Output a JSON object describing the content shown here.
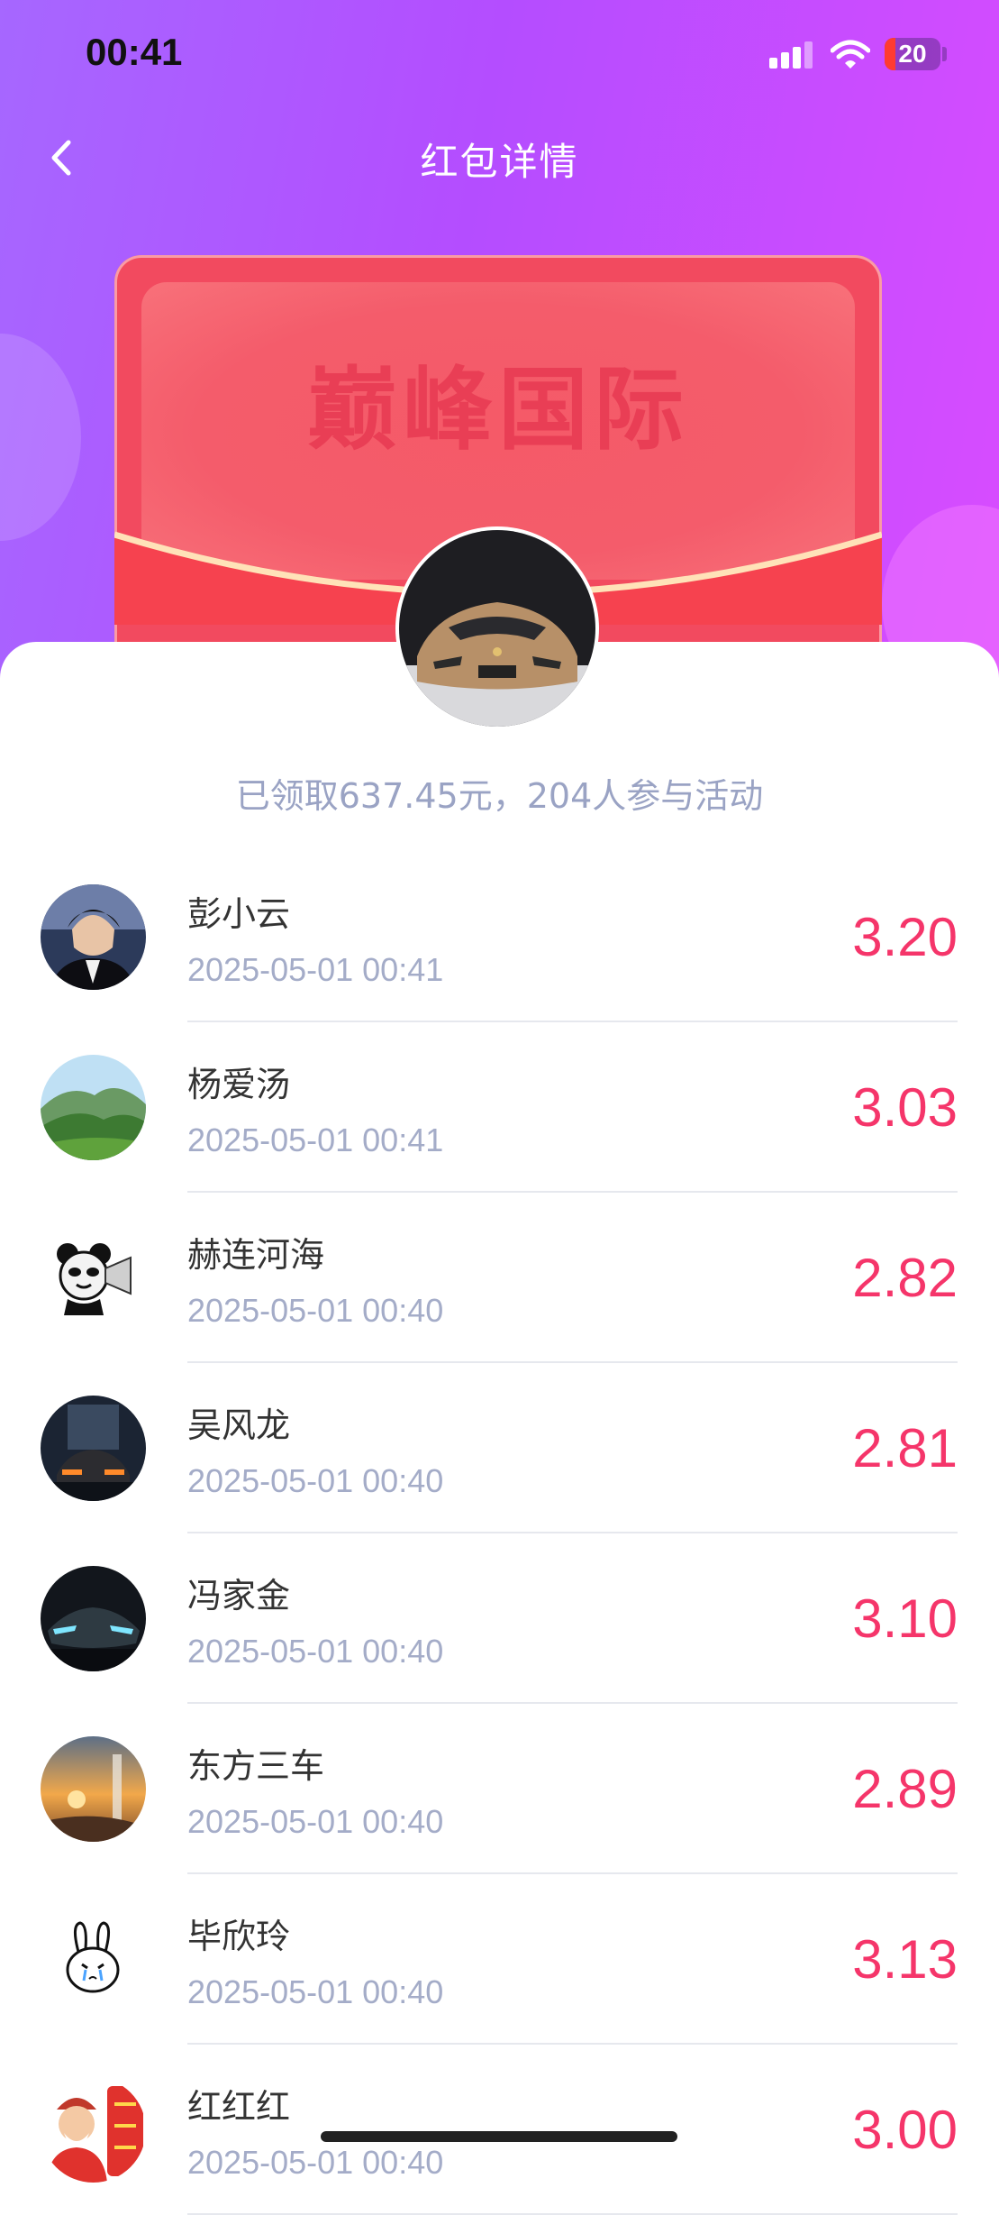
{
  "status_bar": {
    "time": "00:41",
    "battery_level": "20",
    "battery_fraction": 0.2
  },
  "header": {
    "title": "红包详情",
    "back_icon": "chevron-left-icon"
  },
  "envelope": {
    "brand_text": "巅峰国际",
    "color": "#f24a5f",
    "avatar_icon": "car-avatar"
  },
  "summary": {
    "text": "已领取637.45元，204人参与活动"
  },
  "accent_colors": {
    "amount": "#f5356a",
    "header_gradient_start": "#a667ff",
    "header_gradient_end": "#d84cff"
  },
  "claims": [
    {
      "name": "彭小云",
      "time": "2025-05-01 00:41",
      "amount": "3.20",
      "avatar": "man-portrait-avatar"
    },
    {
      "name": "杨爱汤",
      "time": "2025-05-01 00:41",
      "amount": "3.03",
      "avatar": "mountain-landscape-avatar"
    },
    {
      "name": "赫连河海",
      "time": "2025-05-01 00:40",
      "amount": "2.82",
      "avatar": "panda-meme-avatar"
    },
    {
      "name": "吴风龙",
      "time": "2025-05-01 00:40",
      "amount": "2.81",
      "avatar": "sports-car-tunnel-avatar"
    },
    {
      "name": "冯家金",
      "time": "2025-05-01 00:40",
      "amount": "3.10",
      "avatar": "supercar-front-avatar"
    },
    {
      "name": "东方三车",
      "time": "2025-05-01 00:40",
      "amount": "2.89",
      "avatar": "sunset-waterfall-avatar"
    },
    {
      "name": "毕欣玲",
      "time": "2025-05-01 00:40",
      "amount": "3.13",
      "avatar": "crying-rabbit-avatar"
    },
    {
      "name": "红红红",
      "time": "2025-05-01 00:40",
      "amount": "3.00",
      "avatar": "fortune-god-avatar"
    }
  ]
}
